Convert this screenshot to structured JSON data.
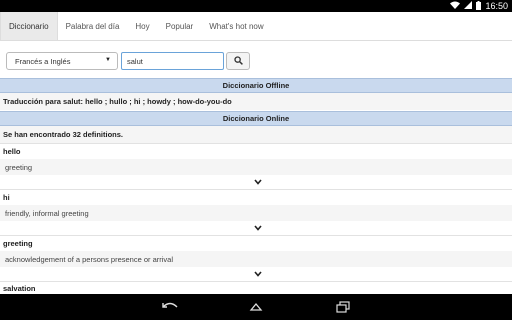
{
  "status_bar": {
    "time": "16:50",
    "icons": [
      "wifi-icon",
      "signal-icon",
      "battery-icon"
    ]
  },
  "tabs": [
    {
      "label": "Diccionario",
      "active": true
    },
    {
      "label": "Palabra del día",
      "active": false
    },
    {
      "label": "Hoy",
      "active": false
    },
    {
      "label": "Popular",
      "active": false
    },
    {
      "label": "What's hot now",
      "active": false
    }
  ],
  "search": {
    "language_select": "Francés a Inglés",
    "query": "salut",
    "button_icon": "search-icon"
  },
  "offline": {
    "header": "Diccionario Offline",
    "translation": "Traducción para salut: hello ; hullo ; hi ; howdy ; how-do-you-do"
  },
  "online": {
    "header": "Diccionario Online",
    "count_text": "Se han encontrado 32 definitions.",
    "entries": [
      {
        "word": "hello",
        "definition": "greeting"
      },
      {
        "word": "hi",
        "definition": "friendly, informal greeting"
      },
      {
        "word": "greeting",
        "definition": "acknowledgement of a persons presence or arrival"
      },
      {
        "word": "salvation",
        "definition": ""
      }
    ]
  },
  "nav": {
    "icons": [
      "back-icon",
      "home-icon",
      "recents-icon"
    ]
  }
}
